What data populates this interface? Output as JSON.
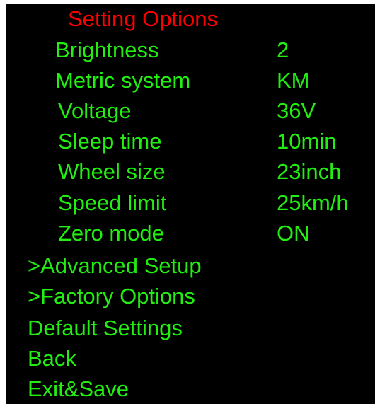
{
  "theme": {
    "background": "#000000",
    "title_color": "#ff0000",
    "text_color": "#22ee11"
  },
  "title": "Setting Options",
  "settings": [
    {
      "label": "Brightness",
      "value": "2"
    },
    {
      "label": "Metric system",
      "value": "KM"
    },
    {
      "label": "Voltage",
      "value": "36V"
    },
    {
      "label": "Sleep time",
      "value": "10min"
    },
    {
      "label": "Wheel size",
      "value": "23inch"
    },
    {
      "label": "Speed limit",
      "value": "25km/h"
    },
    {
      "label": "Zero mode",
      "value": "ON"
    }
  ],
  "menu": {
    "advanced_setup": ">Advanced Setup",
    "factory_options": ">Factory Options",
    "default_settings": "Default Settings",
    "back": "Back",
    "exit_save": "Exit&Save"
  }
}
